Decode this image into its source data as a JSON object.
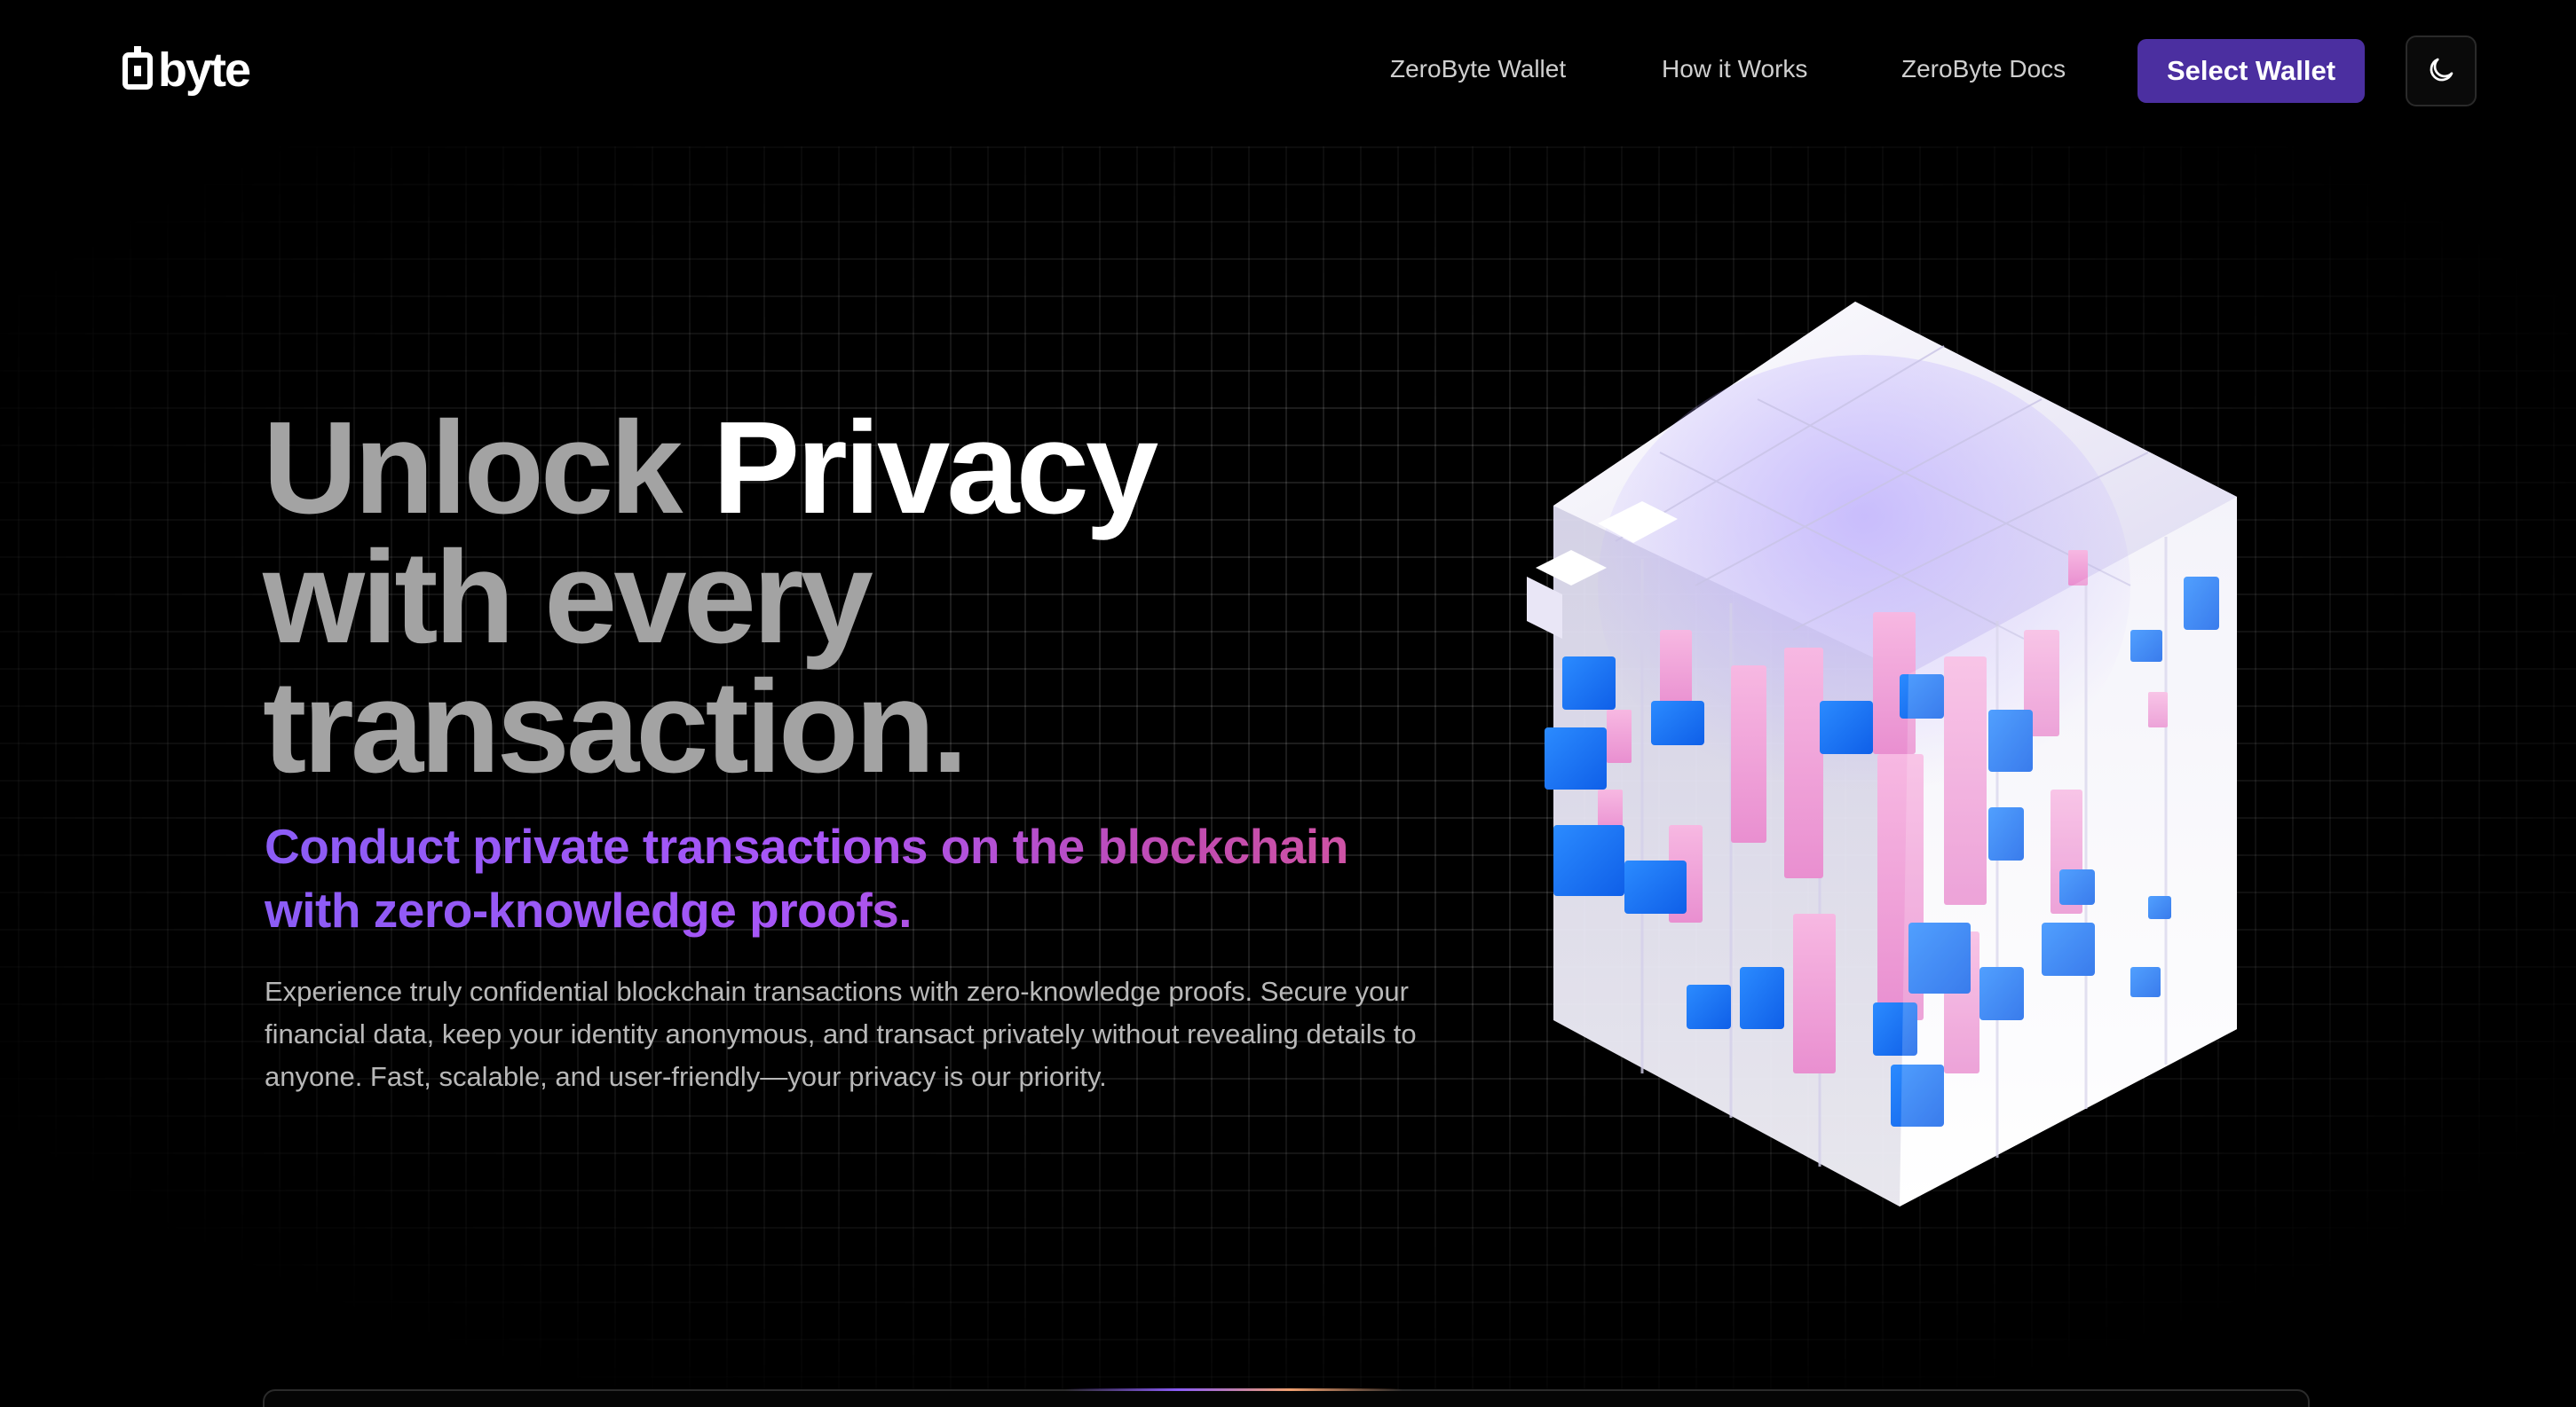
{
  "brand": {
    "name": "byte",
    "logo_icon": "zero-digit-logo-icon"
  },
  "nav": {
    "items": [
      {
        "label": "ZeroByte Wallet"
      },
      {
        "label": "How it Works"
      },
      {
        "label": "ZeroByte Docs"
      }
    ],
    "cta_label": "Select Wallet",
    "theme_icon": "moon-icon"
  },
  "hero": {
    "title_part1": "Unlock",
    "title_accent": "Privacy",
    "title_line2": "with every",
    "title_line3": "transaction.",
    "subtitle_line1": "Conduct private transactions on the blockchain",
    "subtitle_line2": "with zero-knowledge proofs.",
    "description": "Experience truly confidential blockchain transactions with zero-knowledge proofs. Secure your financial data, keep your identity anonymous, and transact privately without revealing details to anyone. Fast, scalable, and user-friendly—your privacy is our priority."
  },
  "colors": {
    "accent": "#4b2fa0",
    "gradient_start": "#8b5cf6",
    "gradient_end": "#db5a9c",
    "cube_blue": "#1a73f5",
    "cube_pink": "#f0a6d8",
    "cube_white": "#eceaf6"
  }
}
